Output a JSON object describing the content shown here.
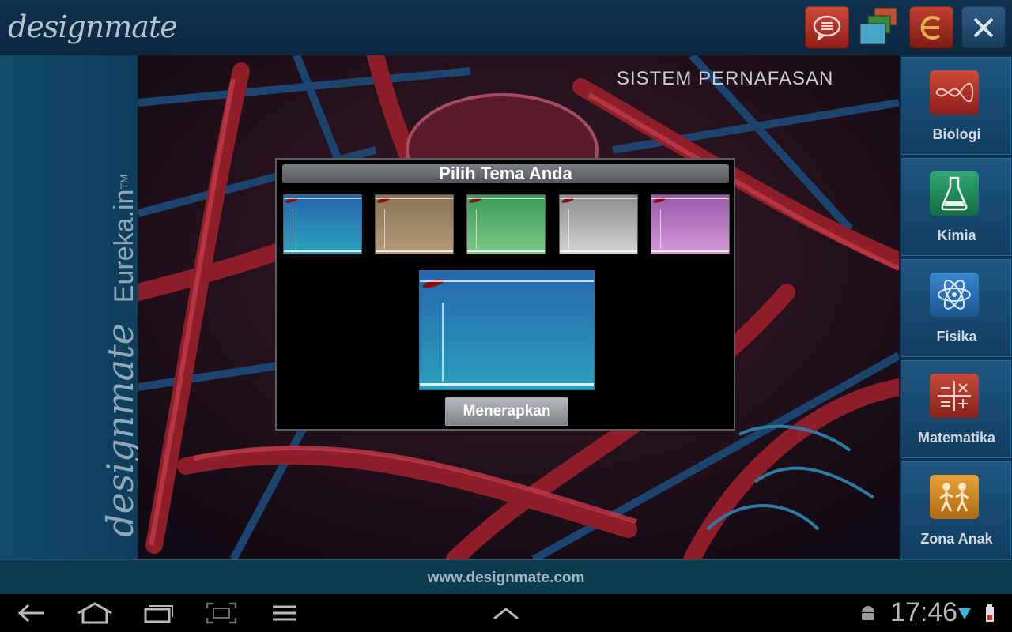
{
  "app": {
    "logo_text": "designmate",
    "vertical_brand": "designmate",
    "vertical_product": "Eureka.in",
    "vertical_tm": "TM"
  },
  "toolbar": {
    "buttons": [
      {
        "icon": "chat-icon"
      },
      {
        "icon": "theme-icon"
      },
      {
        "icon": "eureka-icon"
      },
      {
        "icon": "close-icon"
      }
    ]
  },
  "main": {
    "subject_title": "SISTEM PERNAFASAN"
  },
  "subjects": [
    {
      "label": "Biologi",
      "icon": "dna-icon",
      "color": "#c0392b"
    },
    {
      "label": "Kimia",
      "icon": "flask-icon",
      "color": "#1e8a5a"
    },
    {
      "label": "Fisika",
      "icon": "atom-icon",
      "color": "#2a6fb3"
    },
    {
      "label": "Matematika",
      "icon": "math-icon",
      "color": "#b03a2e"
    },
    {
      "label": "Zona Anak",
      "icon": "kids-icon",
      "color": "#d58a1a"
    }
  ],
  "dialog": {
    "title": "Pilih Tema Anda",
    "themes": [
      {
        "name": "blue",
        "color_top": "#2766ac",
        "color_bottom": "#2ba2bd"
      },
      {
        "name": "brown",
        "color_top": "#8b7458",
        "color_bottom": "#b59c76"
      },
      {
        "name": "green",
        "color_top": "#3c9a56",
        "color_bottom": "#7dc98a"
      },
      {
        "name": "gray",
        "color_top": "#8d8d8d",
        "color_bottom": "#d4d4d4"
      },
      {
        "name": "purple",
        "color_top": "#9a5aa8",
        "color_bottom": "#d49ad9"
      }
    ],
    "apply_label": "Menerapkan"
  },
  "footer": {
    "url": "www.designmate.com"
  },
  "system_bar": {
    "time": "17:46",
    "icons": [
      "back-icon",
      "home-icon",
      "recent-apps-icon",
      "screenshot-icon",
      "menu-icon",
      "up-arrow-icon",
      "android-icon",
      "wifi-icon",
      "battery-icon"
    ]
  }
}
